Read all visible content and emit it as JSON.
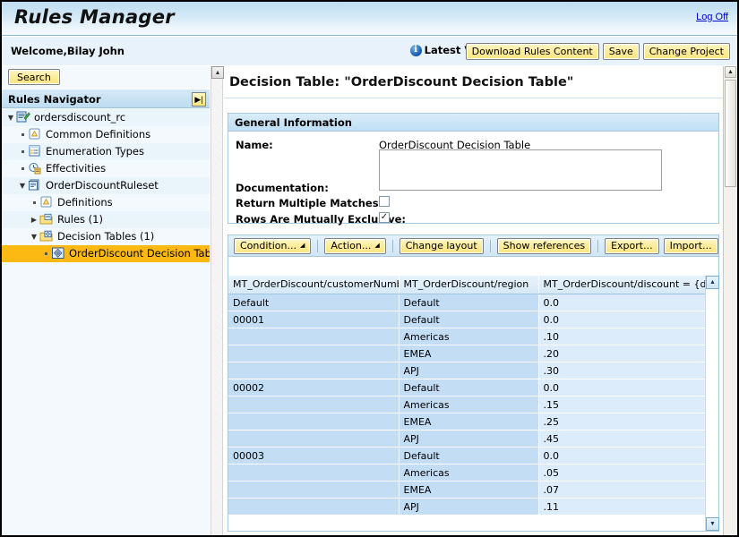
{
  "app": {
    "title": "Rules Manager",
    "logoff_label": "Log Off",
    "welcome_text": "Welcome,Bilay John",
    "version_label": "Latest Version",
    "info_icon_glyph": "i",
    "accent_blue": "#bcdcef",
    "button_yellow": "#fbe480",
    "selection_orange": "#fdb913"
  },
  "toolbar_top": {
    "download_label": "Download Rules Content",
    "save_label": "Save",
    "change_project_label": "Change Project"
  },
  "sidebar": {
    "search_label": "Search",
    "navigator_title": "Rules Navigator",
    "toggle_icon": "collapse-panel-icon",
    "toggle_glyph": "▶|",
    "tree": [
      {
        "label": "ordersdiscount_rc",
        "depth": 0,
        "twist": "expanded",
        "icon": "project-icon",
        "selected": false
      },
      {
        "label": "Common Definitions",
        "depth": 1,
        "twist": "leaf",
        "icon": "definitions-icon",
        "selected": false
      },
      {
        "label": "Enumeration Types",
        "depth": 1,
        "twist": "leaf",
        "icon": "enumeration-icon",
        "selected": false
      },
      {
        "label": "Effectivities",
        "depth": 1,
        "twist": "leaf",
        "icon": "effectivities-icon",
        "selected": false
      },
      {
        "label": "OrderDiscountRuleset",
        "depth": 1,
        "twist": "expanded",
        "icon": "ruleset-icon",
        "selected": false
      },
      {
        "label": "Definitions",
        "depth": 2,
        "twist": "leaf",
        "icon": "definitions-icon",
        "selected": false
      },
      {
        "label": "Rules (1)",
        "depth": 2,
        "twist": "collapsed",
        "icon": "rules-folder-icon",
        "selected": false
      },
      {
        "label": "Decision Tables (1)",
        "depth": 2,
        "twist": "expanded",
        "icon": "tables-folder-icon",
        "selected": false
      },
      {
        "label": "OrderDiscount Decision Table",
        "depth": 3,
        "twist": "leaf",
        "icon": "decision-table-icon",
        "selected": true
      }
    ]
  },
  "main": {
    "page_title": "Decision Table: \"OrderDiscount Decision Table\"",
    "general": {
      "section_title": "General Information",
      "name_label": "Name:",
      "name_value": "OrderDiscount Decision Table",
      "documentation_label": "Documentation:",
      "documentation_value": "",
      "documentation_placeholder": "",
      "return_multiple_label": "Return Multiple Matches:",
      "return_multiple_checked": false,
      "mutually_exclusive_label": "Rows Are Mutually Exclusive:",
      "mutually_exclusive_checked": true,
      "checked_glyph": "✓"
    },
    "table_toolbar": {
      "condition_label": "Condition...",
      "action_label": "Action...",
      "change_layout_label": "Change layout",
      "show_references_label": "Show references",
      "export_label": "Export...",
      "import_label": "Import...",
      "dropdown_glyph": "◢"
    },
    "decision_table": {
      "columns": [
        "MT_OrderDiscount/customerNumber",
        "MT_OrderDiscount/region",
        "MT_OrderDiscount/discount = {double}"
      ],
      "rows": [
        {
          "customerNumber": "Default",
          "region": "Default",
          "discount": "0.0"
        },
        {
          "customerNumber": "00001",
          "region": "Default",
          "discount": "0.0"
        },
        {
          "customerNumber": "",
          "region": "Americas",
          "discount": ".10"
        },
        {
          "customerNumber": "",
          "region": "EMEA",
          "discount": ".20"
        },
        {
          "customerNumber": "",
          "region": "APJ",
          "discount": ".30"
        },
        {
          "customerNumber": "00002",
          "region": "Default",
          "discount": "0.0"
        },
        {
          "customerNumber": "",
          "region": "Americas",
          "discount": ".15"
        },
        {
          "customerNumber": "",
          "region": "EMEA",
          "discount": ".25"
        },
        {
          "customerNumber": "",
          "region": "APJ",
          "discount": ".45"
        },
        {
          "customerNumber": "00003",
          "region": "Default",
          "discount": "0.0"
        },
        {
          "customerNumber": "",
          "region": "Americas",
          "discount": ".05"
        },
        {
          "customerNumber": "",
          "region": "EMEA",
          "discount": ".07"
        },
        {
          "customerNumber": "",
          "region": "APJ",
          "discount": ".11"
        }
      ],
      "scroll_up_glyph": "▲",
      "scroll_down_glyph": "▼"
    }
  }
}
